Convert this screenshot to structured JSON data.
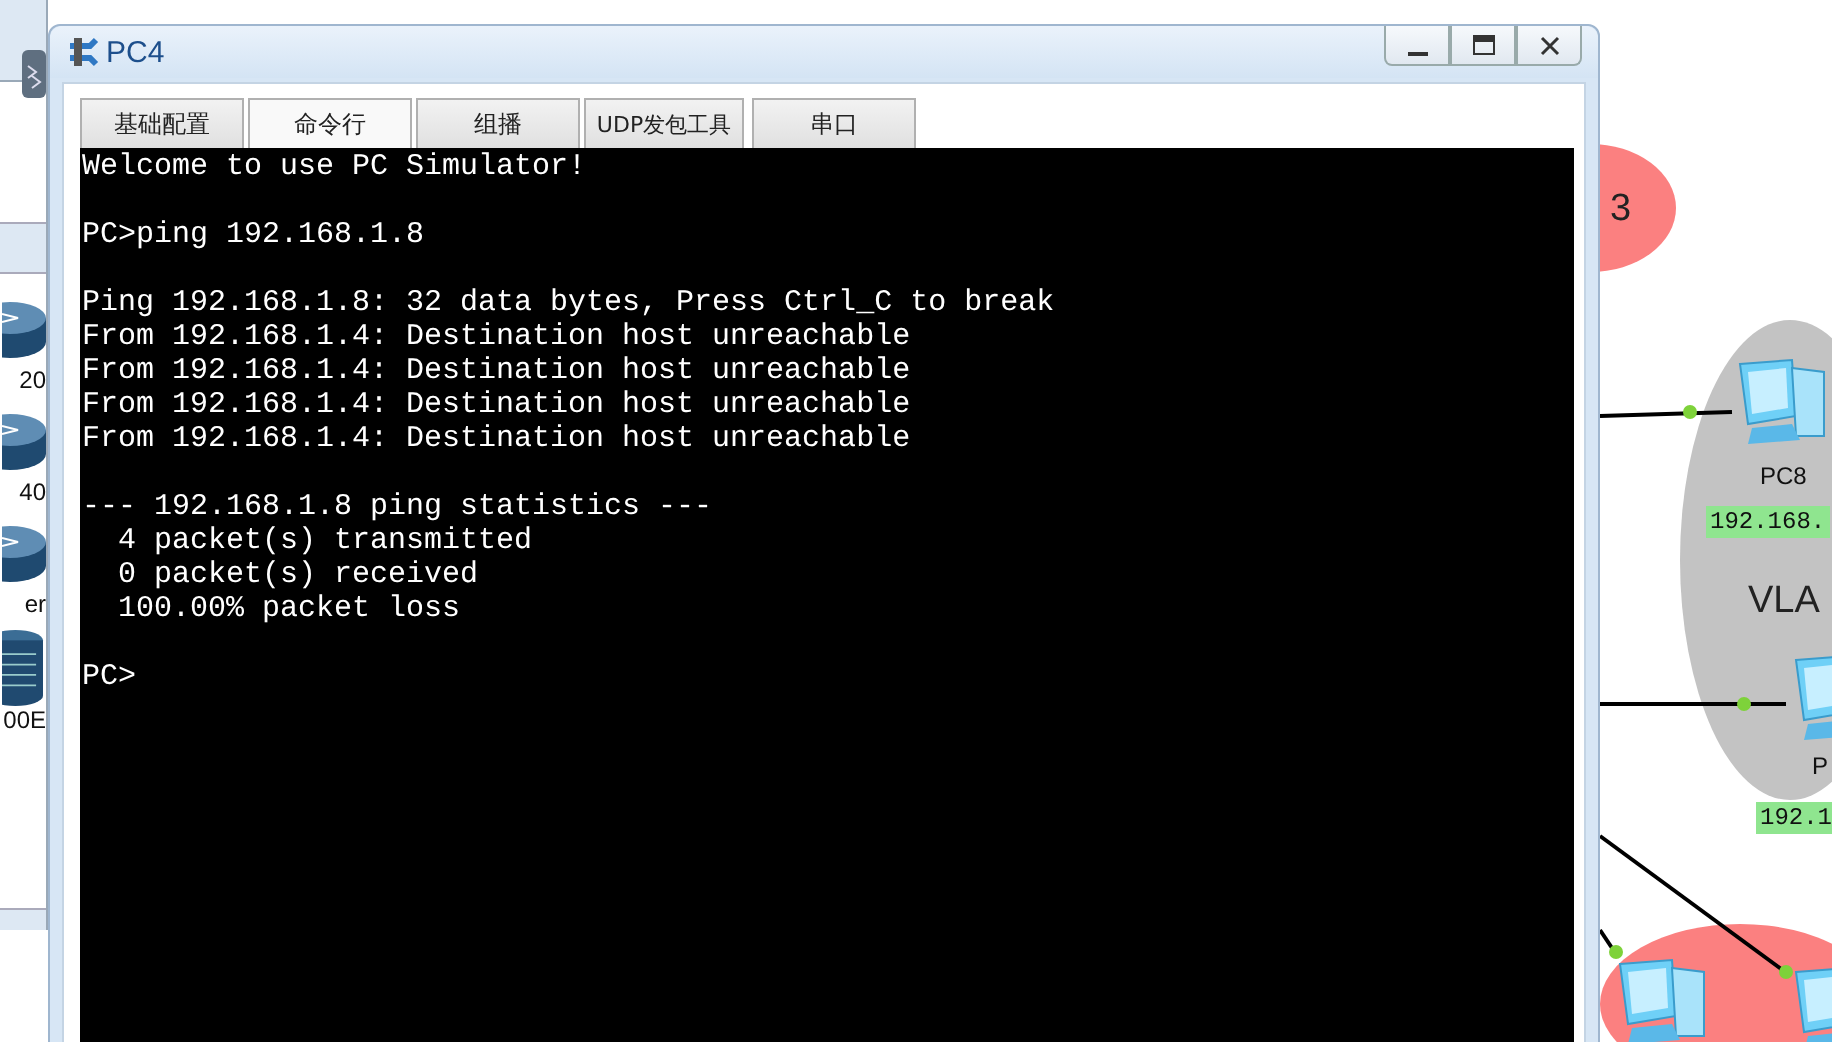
{
  "sidebar": {
    "devices": [
      {
        "label": "20"
      },
      {
        "label": "40"
      },
      {
        "label": "er"
      },
      {
        "label": "00E"
      }
    ]
  },
  "canvas": {
    "areas": [
      {
        "label": "3",
        "color": "#fb8080"
      },
      {
        "label": "VLA",
        "color": "#c3c3c3"
      },
      {
        "color": "#fb8080"
      }
    ],
    "nodes": [
      {
        "kind": "pc",
        "label": "PC8",
        "ip": "192.168."
      },
      {
        "kind": "pc",
        "label": "P",
        "ip": "192.1"
      },
      {
        "kind": "pc"
      },
      {
        "kind": "pc"
      }
    ]
  },
  "window": {
    "title": "PC4",
    "tabs": [
      {
        "label": "基础配置",
        "selected": false
      },
      {
        "label": "命令行",
        "selected": true
      },
      {
        "label": "组播",
        "selected": false
      },
      {
        "label": "UDP发包工具",
        "selected": false
      },
      {
        "label": "串口",
        "selected": false
      }
    ],
    "terminal": [
      [
        "Welcome to use PC Simulator!"
      ],
      [
        "PC>ping 192.168.1.8"
      ],
      [
        "Ping 192.168.1.8: 32 data bytes, Press Ctrl_C to break",
        "From 192.168.1.4: Destination host unreachable",
        "From 192.168.1.4: Destination host unreachable",
        "From 192.168.1.4: Destination host unreachable",
        "From 192.168.1.4: Destination host unreachable"
      ],
      [
        "--- 192.168.1.8 ping statistics ---",
        "  4 packet(s) transmitted",
        "  0 packet(s) received",
        "  100.00% packet loss"
      ],
      [
        "PC>"
      ]
    ]
  }
}
